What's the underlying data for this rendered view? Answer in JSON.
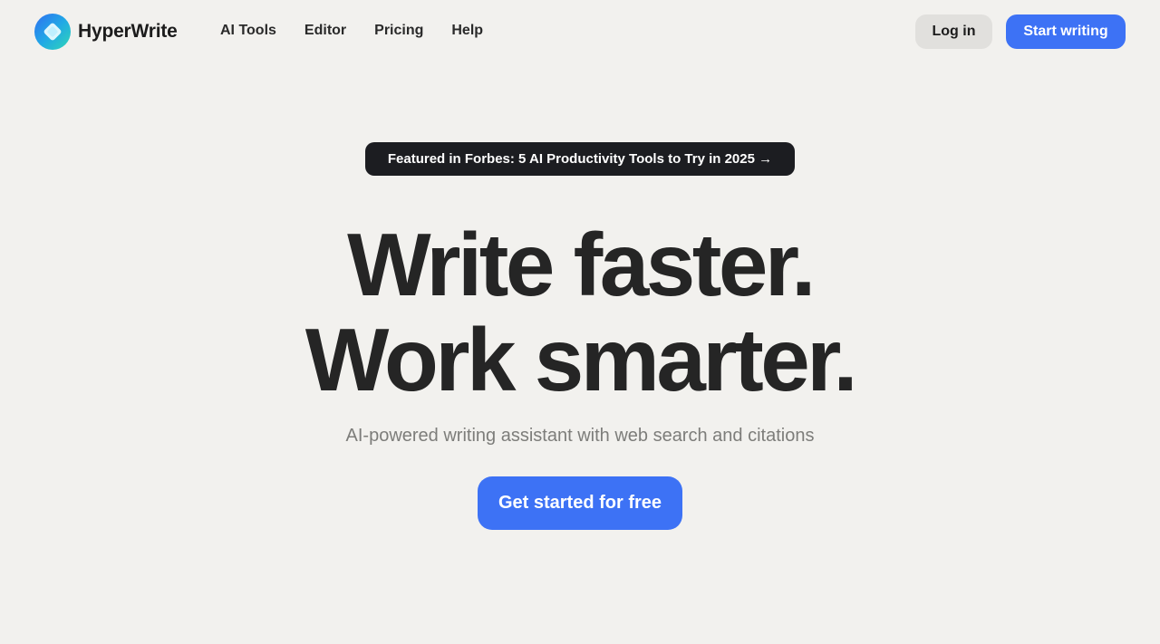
{
  "brand": {
    "name": "HyperWrite"
  },
  "nav": {
    "items": [
      {
        "label": "AI Tools"
      },
      {
        "label": "Editor"
      },
      {
        "label": "Pricing"
      },
      {
        "label": "Help"
      }
    ]
  },
  "header": {
    "login_label": "Log in",
    "start_label": "Start writing"
  },
  "hero": {
    "banner": "Featured in Forbes: 5 AI Productivity Tools to Try in 2025 →",
    "headline_line1": "Write faster.",
    "headline_line2": "Work smarter.",
    "subtitle": "AI-powered writing assistant with web search and citations",
    "cta_label": "Get started for free"
  },
  "colors": {
    "background": "#f2f1ee",
    "accent": "#3d72f5",
    "banner_bg": "#1c1d21",
    "text": "#252525"
  }
}
